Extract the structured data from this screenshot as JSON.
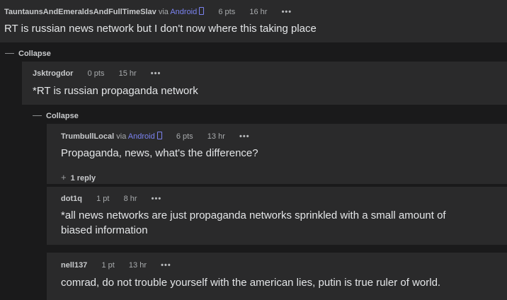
{
  "comments": [
    {
      "user": "TauntaunsAndEmeraldsAndFullTimeSlav",
      "via": "via",
      "platform": "Android",
      "points": "6 pts",
      "time": "16 hr",
      "more": "•••",
      "text": "RT is russian news network but I don't now where this taking place"
    },
    {
      "user": "Jsktrogdor",
      "points": "0 pts",
      "time": "15 hr",
      "more": "•••",
      "text": "*RT is russian propaganda network"
    },
    {
      "user": "TrumbullLocal",
      "via": "via",
      "platform": "Android",
      "points": "6 pts",
      "time": "13 hr",
      "more": "•••",
      "text": "Propaganda, news, what's the difference?",
      "replies": "1 reply"
    },
    {
      "user": "dot1q",
      "points": "1 pt",
      "time": "8 hr",
      "more": "•••",
      "text_line1": "*all news networks are just propaganda networks sprinkled with a small amount of",
      "text_line2": "biased information"
    },
    {
      "user": "nell137",
      "points": "1 pt",
      "time": "13 hr",
      "more": "•••",
      "text": "comrad, do not trouble yourself with the american lies, putin is true ruler of world."
    }
  ],
  "collapse_label": "Collapse",
  "collapse_symbol": "—",
  "expand_symbol": "+",
  "colors": {
    "background": "#1a1a1b",
    "card": "#2a2a2b",
    "android_link": "#7b83f0"
  }
}
